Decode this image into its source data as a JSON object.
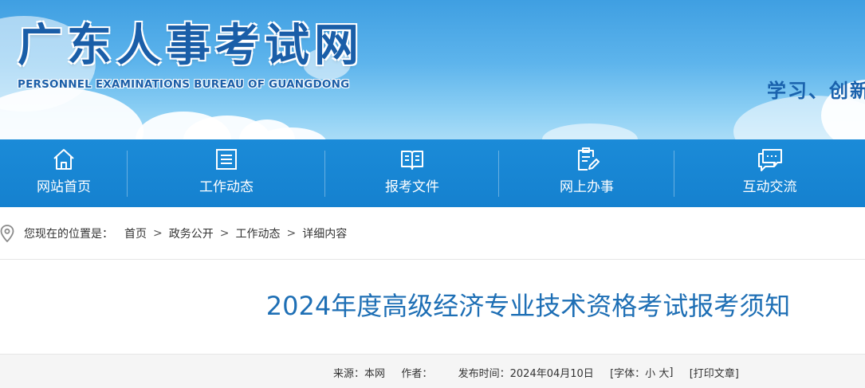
{
  "header": {
    "site_title": "广东人事考试网",
    "site_subtitle": "PERSONNEL EXAMINATIONS BUREAU OF GUANGDONG",
    "slogan": "学习、创新"
  },
  "nav": {
    "items": [
      {
        "label": "网站首页",
        "icon": "home-icon"
      },
      {
        "label": "工作动态",
        "icon": "news-list-icon"
      },
      {
        "label": "报考文件",
        "icon": "open-book-icon"
      },
      {
        "label": "网上办事",
        "icon": "clipboard-pen-icon"
      },
      {
        "label": "互动交流",
        "icon": "chat-bubbles-icon"
      }
    ]
  },
  "breadcrumb": {
    "prefix": "您现在的位置是：",
    "items": [
      "首页",
      "政务公开",
      "工作动态",
      "详细内容"
    ],
    "separator": ">"
  },
  "article": {
    "title": "2024年度高级经济专业技术资格考试报考须知",
    "source_label": "来源：",
    "source": "本网",
    "author_label": "作者：",
    "author": "",
    "date_label": "发布时间：",
    "date": "2024年04月10日",
    "font_label": "[字体：",
    "font_small": "小",
    "font_large": "大",
    "font_close": "]",
    "print": "[打印文章]"
  },
  "colors": {
    "nav_bg": "#1581cf",
    "title_blue": "#1e6fb5",
    "logo_blue": "#1a5ea8"
  }
}
